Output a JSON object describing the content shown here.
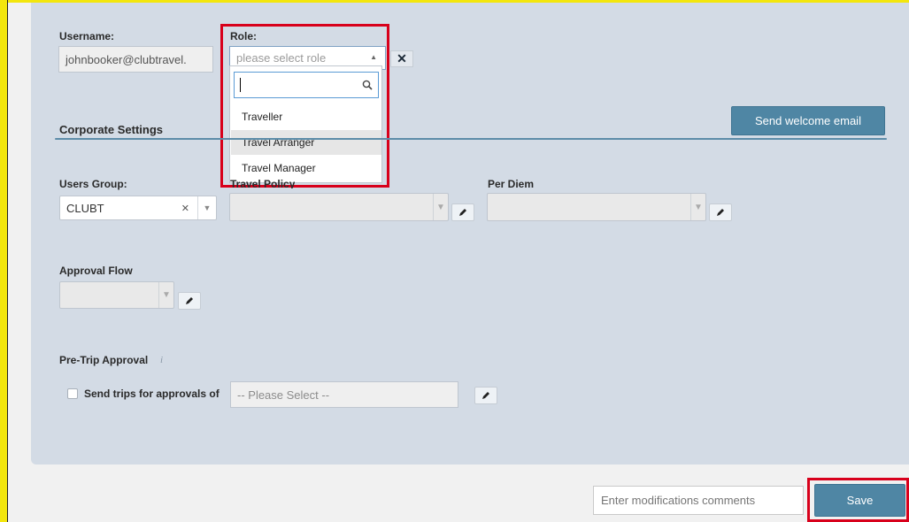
{
  "username": {
    "label": "Username:",
    "value": "johnbooker@clubtravel."
  },
  "role": {
    "label": "Role:",
    "placeholder": "please select role",
    "search_value": "",
    "options": [
      "Traveller",
      "Travel Arranger",
      "Travel Manager"
    ],
    "highlighted_index": 1
  },
  "corporate": {
    "title": "Corporate Settings",
    "send_welcome_label": "Send welcome email"
  },
  "users_group": {
    "label": "Users Group:",
    "value": "CLUBT"
  },
  "travel_policy": {
    "label_partial": "Travel Policy",
    "value": ""
  },
  "per_diem": {
    "label": "Per Diem",
    "value": ""
  },
  "approval_flow": {
    "label": "Approval Flow",
    "value": ""
  },
  "pretrip": {
    "label": "Pre-Trip Approval",
    "info_glyph": "i",
    "checkbox_label": "Send trips for approvals of",
    "select_placeholder": "-- Please Select --"
  },
  "footer": {
    "comments_placeholder": "Enter modifications comments",
    "save_label": "Save"
  },
  "colors": {
    "panel": "#d3dbe5",
    "accent": "#4f86a4",
    "highlight_border": "#d8001b",
    "frame": "#f3e60c"
  }
}
